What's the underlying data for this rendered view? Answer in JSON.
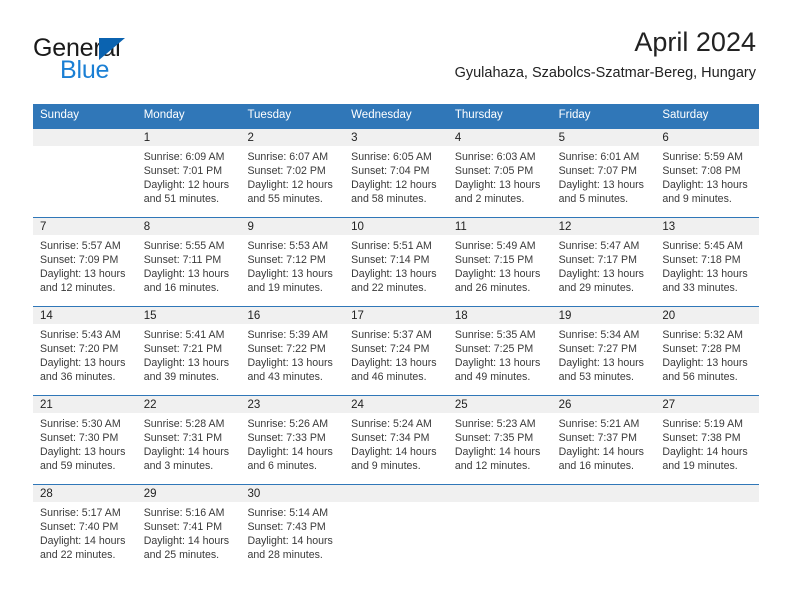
{
  "brand": {
    "name_top": "General",
    "name_bottom": "Blue",
    "triangle_color": "#0b63b0",
    "blue_color": "#1a7fd4"
  },
  "header": {
    "title": "April 2024",
    "subtitle": "Gyulahaza, Szabolcs-Szatmar-Bereg, Hungary"
  },
  "theme": {
    "header_blue": "#3077b8",
    "day_band_gray": "#f0f0f0",
    "text": "#222222"
  },
  "weekdays": [
    "Sunday",
    "Monday",
    "Tuesday",
    "Wednesday",
    "Thursday",
    "Friday",
    "Saturday"
  ],
  "weeks": [
    [
      {
        "day": "",
        "sunrise": "",
        "sunset": "",
        "daylight": "",
        "empty": true
      },
      {
        "day": "1",
        "sunrise": "Sunrise: 6:09 AM",
        "sunset": "Sunset: 7:01 PM",
        "daylight": "Daylight: 12 hours and 51 minutes."
      },
      {
        "day": "2",
        "sunrise": "Sunrise: 6:07 AM",
        "sunset": "Sunset: 7:02 PM",
        "daylight": "Daylight: 12 hours and 55 minutes."
      },
      {
        "day": "3",
        "sunrise": "Sunrise: 6:05 AM",
        "sunset": "Sunset: 7:04 PM",
        "daylight": "Daylight: 12 hours and 58 minutes."
      },
      {
        "day": "4",
        "sunrise": "Sunrise: 6:03 AM",
        "sunset": "Sunset: 7:05 PM",
        "daylight": "Daylight: 13 hours and 2 minutes."
      },
      {
        "day": "5",
        "sunrise": "Sunrise: 6:01 AM",
        "sunset": "Sunset: 7:07 PM",
        "daylight": "Daylight: 13 hours and 5 minutes."
      },
      {
        "day": "6",
        "sunrise": "Sunrise: 5:59 AM",
        "sunset": "Sunset: 7:08 PM",
        "daylight": "Daylight: 13 hours and 9 minutes."
      }
    ],
    [
      {
        "day": "7",
        "sunrise": "Sunrise: 5:57 AM",
        "sunset": "Sunset: 7:09 PM",
        "daylight": "Daylight: 13 hours and 12 minutes."
      },
      {
        "day": "8",
        "sunrise": "Sunrise: 5:55 AM",
        "sunset": "Sunset: 7:11 PM",
        "daylight": "Daylight: 13 hours and 16 minutes."
      },
      {
        "day": "9",
        "sunrise": "Sunrise: 5:53 AM",
        "sunset": "Sunset: 7:12 PM",
        "daylight": "Daylight: 13 hours and 19 minutes."
      },
      {
        "day": "10",
        "sunrise": "Sunrise: 5:51 AM",
        "sunset": "Sunset: 7:14 PM",
        "daylight": "Daylight: 13 hours and 22 minutes."
      },
      {
        "day": "11",
        "sunrise": "Sunrise: 5:49 AM",
        "sunset": "Sunset: 7:15 PM",
        "daylight": "Daylight: 13 hours and 26 minutes."
      },
      {
        "day": "12",
        "sunrise": "Sunrise: 5:47 AM",
        "sunset": "Sunset: 7:17 PM",
        "daylight": "Daylight: 13 hours and 29 minutes."
      },
      {
        "day": "13",
        "sunrise": "Sunrise: 5:45 AM",
        "sunset": "Sunset: 7:18 PM",
        "daylight": "Daylight: 13 hours and 33 minutes."
      }
    ],
    [
      {
        "day": "14",
        "sunrise": "Sunrise: 5:43 AM",
        "sunset": "Sunset: 7:20 PM",
        "daylight": "Daylight: 13 hours and 36 minutes."
      },
      {
        "day": "15",
        "sunrise": "Sunrise: 5:41 AM",
        "sunset": "Sunset: 7:21 PM",
        "daylight": "Daylight: 13 hours and 39 minutes."
      },
      {
        "day": "16",
        "sunrise": "Sunrise: 5:39 AM",
        "sunset": "Sunset: 7:22 PM",
        "daylight": "Daylight: 13 hours and 43 minutes."
      },
      {
        "day": "17",
        "sunrise": "Sunrise: 5:37 AM",
        "sunset": "Sunset: 7:24 PM",
        "daylight": "Daylight: 13 hours and 46 minutes."
      },
      {
        "day": "18",
        "sunrise": "Sunrise: 5:35 AM",
        "sunset": "Sunset: 7:25 PM",
        "daylight": "Daylight: 13 hours and 49 minutes."
      },
      {
        "day": "19",
        "sunrise": "Sunrise: 5:34 AM",
        "sunset": "Sunset: 7:27 PM",
        "daylight": "Daylight: 13 hours and 53 minutes."
      },
      {
        "day": "20",
        "sunrise": "Sunrise: 5:32 AM",
        "sunset": "Sunset: 7:28 PM",
        "daylight": "Daylight: 13 hours and 56 minutes."
      }
    ],
    [
      {
        "day": "21",
        "sunrise": "Sunrise: 5:30 AM",
        "sunset": "Sunset: 7:30 PM",
        "daylight": "Daylight: 13 hours and 59 minutes."
      },
      {
        "day": "22",
        "sunrise": "Sunrise: 5:28 AM",
        "sunset": "Sunset: 7:31 PM",
        "daylight": "Daylight: 14 hours and 3 minutes."
      },
      {
        "day": "23",
        "sunrise": "Sunrise: 5:26 AM",
        "sunset": "Sunset: 7:33 PM",
        "daylight": "Daylight: 14 hours and 6 minutes."
      },
      {
        "day": "24",
        "sunrise": "Sunrise: 5:24 AM",
        "sunset": "Sunset: 7:34 PM",
        "daylight": "Daylight: 14 hours and 9 minutes."
      },
      {
        "day": "25",
        "sunrise": "Sunrise: 5:23 AM",
        "sunset": "Sunset: 7:35 PM",
        "daylight": "Daylight: 14 hours and 12 minutes."
      },
      {
        "day": "26",
        "sunrise": "Sunrise: 5:21 AM",
        "sunset": "Sunset: 7:37 PM",
        "daylight": "Daylight: 14 hours and 16 minutes."
      },
      {
        "day": "27",
        "sunrise": "Sunrise: 5:19 AM",
        "sunset": "Sunset: 7:38 PM",
        "daylight": "Daylight: 14 hours and 19 minutes."
      }
    ],
    [
      {
        "day": "28",
        "sunrise": "Sunrise: 5:17 AM",
        "sunset": "Sunset: 7:40 PM",
        "daylight": "Daylight: 14 hours and 22 minutes."
      },
      {
        "day": "29",
        "sunrise": "Sunrise: 5:16 AM",
        "sunset": "Sunset: 7:41 PM",
        "daylight": "Daylight: 14 hours and 25 minutes."
      },
      {
        "day": "30",
        "sunrise": "Sunrise: 5:14 AM",
        "sunset": "Sunset: 7:43 PM",
        "daylight": "Daylight: 14 hours and 28 minutes."
      },
      {
        "day": "",
        "sunrise": "",
        "sunset": "",
        "daylight": "",
        "empty": true
      },
      {
        "day": "",
        "sunrise": "",
        "sunset": "",
        "daylight": "",
        "empty": true
      },
      {
        "day": "",
        "sunrise": "",
        "sunset": "",
        "daylight": "",
        "empty": true
      },
      {
        "day": "",
        "sunrise": "",
        "sunset": "",
        "daylight": "",
        "empty": true
      }
    ]
  ]
}
